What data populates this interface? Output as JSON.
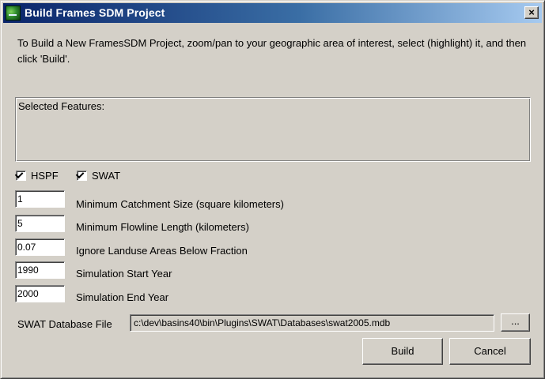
{
  "window": {
    "title": "Build Frames SDM Project",
    "close_glyph": "×",
    "icon": "app-map-icon"
  },
  "instructions": "To Build a New FramesSDM Project, zoom/pan to your geographic area of interest, select (highlight) it, and then click 'Build'.",
  "selected_features": {
    "label": "Selected Features:"
  },
  "options": {
    "hspf": {
      "label": "HSPF",
      "checked": true
    },
    "swat": {
      "label": "SWAT",
      "checked": true
    }
  },
  "fields": [
    {
      "value": "1",
      "label": "Minimum Catchment Size (square kilometers)"
    },
    {
      "value": "5",
      "label": "Minimum Flowline Length (kilometers)"
    },
    {
      "value": "0.07",
      "label": "Ignore Landuse Areas Below Fraction"
    },
    {
      "value": "1990",
      "label": "Simulation Start Year"
    },
    {
      "value": "2000",
      "label": "Simulation End Year"
    }
  ],
  "database": {
    "label": "SWAT Database File",
    "path": "c:\\dev\\basins40\\bin\\Plugins\\SWAT\\Databases\\swat2005.mdb",
    "browse_label": "..."
  },
  "buttons": {
    "build": "Build",
    "cancel": "Cancel"
  }
}
